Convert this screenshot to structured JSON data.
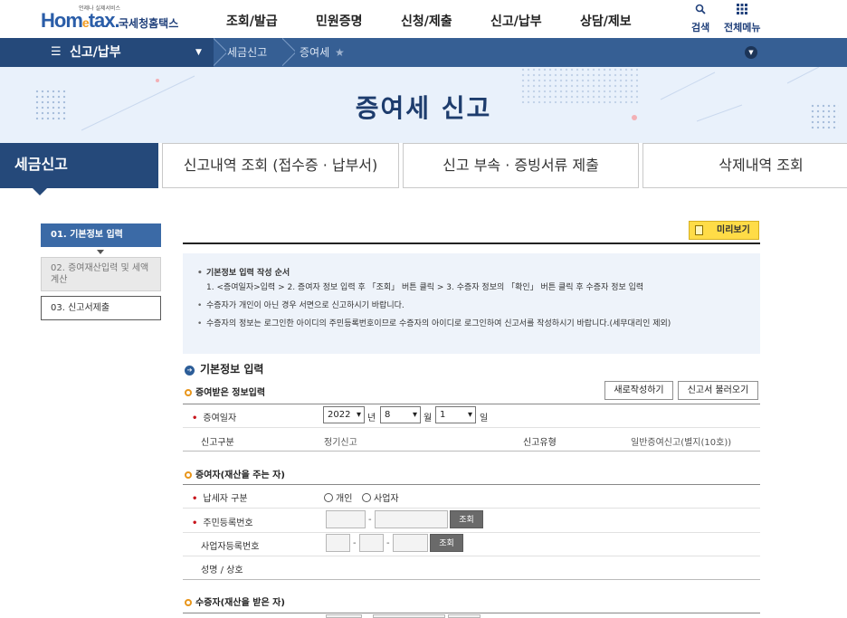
{
  "header": {
    "logo_small": "언제나 실제서비스",
    "logo_home": "Hom",
    "logo_e": "e",
    "logo_tax": "tax.",
    "logo_korean": "국세청홈택스",
    "menu": [
      "조회/발급",
      "민원증명",
      "신청/제출",
      "신고/납부",
      "상담/제보"
    ],
    "search_label": "검색",
    "allmenu_label": "전체메뉴"
  },
  "nav": {
    "section": "신고/납부",
    "crumbs": [
      "세금신고",
      "증여세"
    ],
    "star": "★"
  },
  "banner": {
    "title": "증여세 신고"
  },
  "tabs": [
    "세금신고",
    "신고내역 조회 (접수증 · 납부서)",
    "신고 부속 · 증빙서류 제출",
    "삭제내역 조회"
  ],
  "steps": [
    "01. 기본정보 입력",
    "02. 증여재산입력 및 세액계산",
    "03. 신고서제출"
  ],
  "preview_label": "미리보기",
  "guide": {
    "title": "기본정보 입력 작성 순서",
    "order": "1. <증여일자>입력 > 2. 증여자 정보 입력 후 「조회」 버튼 클릭 > 3. 수증자 정보의 「확인」 버튼 클릭 후 수증자 정보 입력",
    "note1": "수증자가 개인이 아닌 경우 서면으로 신고하시기 바랍니다.",
    "note2": "수증자의 정보는 로그인한 아이디의 주민등록번호이므로 수증자의 아이디로 로그인하여 신고서를 작성하시기 바랍니다.(세무대리인 제외)"
  },
  "basic": {
    "title": "기본정보 입력",
    "gift_section": "증여받은 정보입력",
    "new_btn": "새로작성하기",
    "load_btn": "신고서 불러오기",
    "gift_date_label": "증여일자",
    "year": "2022",
    "year_unit": "년",
    "month": "8",
    "month_unit": "월",
    "day": "1",
    "day_unit": "일",
    "report_type_label": "신고구분",
    "report_type_value": "정기신고",
    "report_kind_label": "신고유형",
    "report_kind_value": "일반증여신고(별지(10호))"
  },
  "donor": {
    "title": "증여자(재산을 주는 자)",
    "taxpayer_type_label": "납세자 구분",
    "opt_person": "개인",
    "opt_business": "사업자",
    "rrn_label": "주민등록번호",
    "brn_label": "사업자등록번호",
    "name_label": "성명 / 상호",
    "lookup": "조회",
    "dash": "-"
  },
  "donee": {
    "title": "수증자(재산을 받은 자)"
  }
}
